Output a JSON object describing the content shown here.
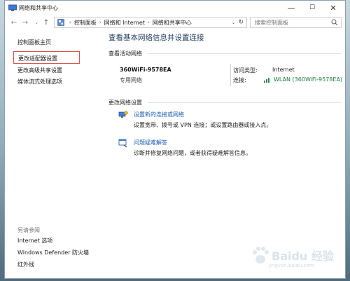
{
  "window": {
    "title": "网络和共享中心",
    "minimize": "—",
    "maximize": "☐",
    "close": "✕"
  },
  "toolbar": {
    "breadcrumb": [
      "控制面板",
      "网络和 Internet",
      "网络和共享中心"
    ],
    "search_placeholder": "搜索控制面板"
  },
  "sidebar": {
    "items": [
      {
        "label": "控制面板主页"
      },
      {
        "label": "更改适配器设置"
      },
      {
        "label": "更改高级共享设置"
      },
      {
        "label": "媒体流式处理选项"
      }
    ],
    "see_also_title": "另请参阅",
    "see_also": [
      {
        "label": "Internet 选项"
      },
      {
        "label": "Windows Defender 防火墙"
      },
      {
        "label": "红外线"
      }
    ]
  },
  "main": {
    "title": "查看基本网络信息并设置连接",
    "active_section": "查看活动网络",
    "network": {
      "name": "360WiFi-9578EA",
      "type": "专用网络",
      "access_label": "访问类型:",
      "access_value": "Internet",
      "conn_label": "连接:",
      "conn_value": "WLAN (360WiFi-9578EA)"
    },
    "change_section": "更改网络设置",
    "tasks": [
      {
        "title": "设置新的连接或网络",
        "desc": "设置宽带、拨号或 VPN 连接；或设置路由器或接入点。",
        "icon": "network-setup-icon"
      },
      {
        "title": "问题疑难解答",
        "desc": "诊断并修复网络问题，或者获得疑难解答信息。",
        "icon": "troubleshoot-icon"
      }
    ]
  },
  "watermark": {
    "text": "Baidu 经验",
    "url": "jingyan.baidu.com"
  }
}
